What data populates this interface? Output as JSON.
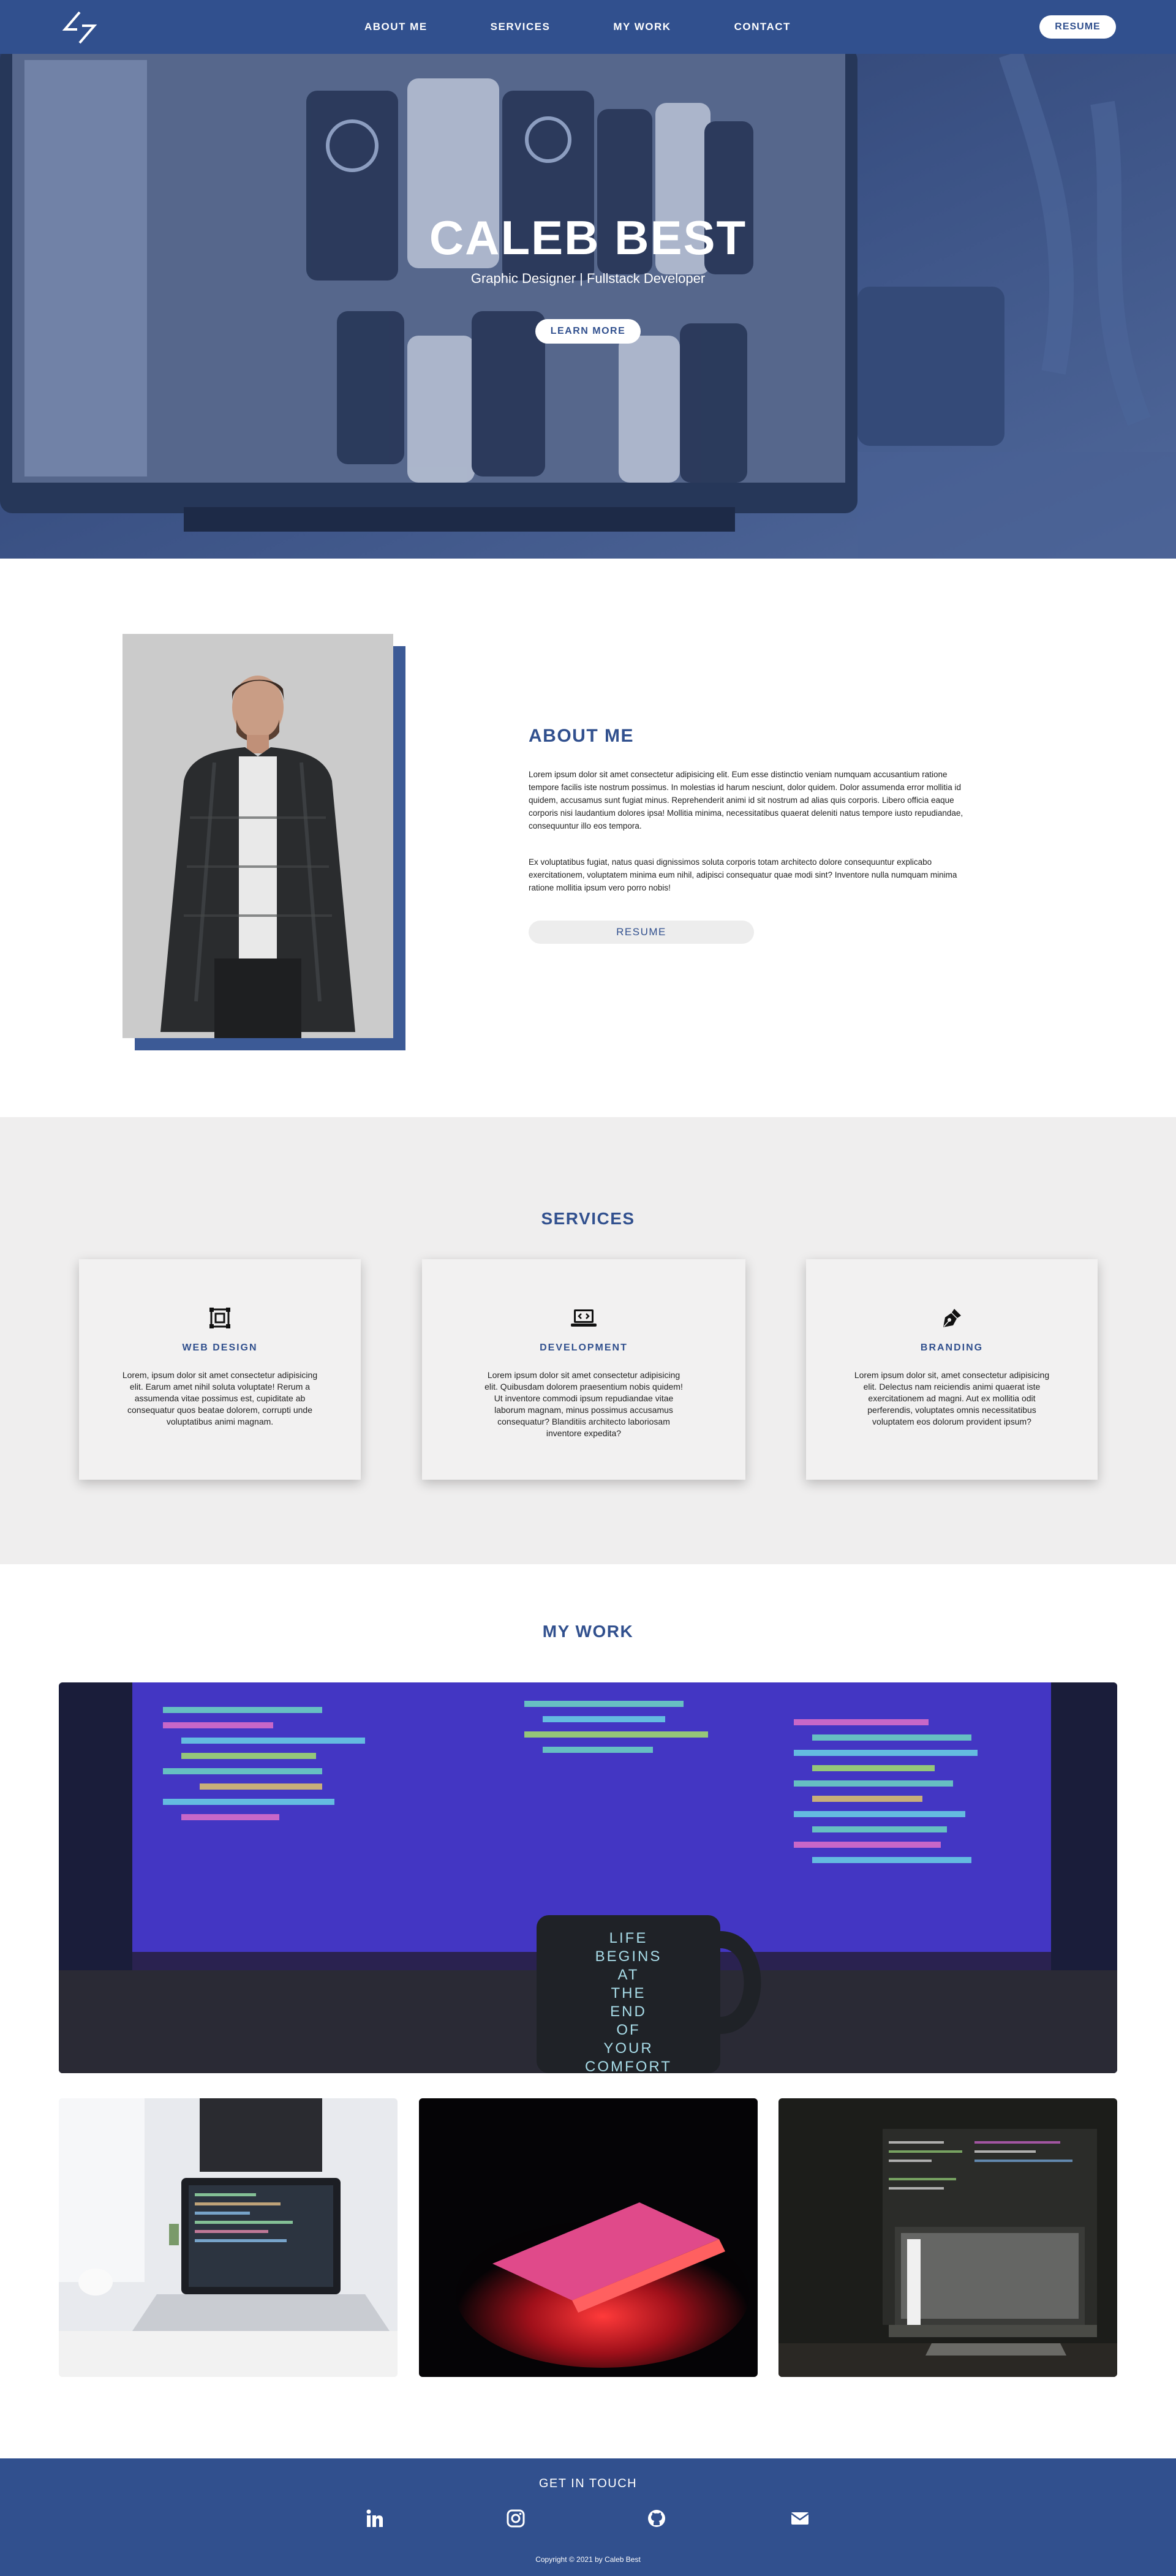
{
  "nav": {
    "logo_icon": "lightning-logo-icon",
    "links": [
      "ABOUT ME",
      "SERVICES",
      "MY WORK",
      "CONTACT"
    ],
    "resume_label": "RESUME"
  },
  "hero": {
    "title": "CALEB BEST",
    "subtitle": "Graphic Designer | Fullstack Developer",
    "button_label": "LEARN MORE"
  },
  "about": {
    "title": "ABOUT ME",
    "paragraph1": "Lorem ipsum dolor sit amet consectetur adipisicing elit. Eum esse distinctio veniam numquam accusantium ratione tempore facilis iste nostrum possimus. In molestias id harum nesciunt, dolor quidem. Dolor assumenda error mollitia id quidem, accusamus sunt fugiat minus. Reprehenderit animi id sit nostrum ad alias quis corporis. Libero officia eaque corporis nisi laudantium dolores ipsa! Mollitia minima, necessitatibus quaerat deleniti natus tempore iusto repudiandae, consequuntur illo eos tempora.",
    "paragraph2": "Ex voluptatibus fugiat, natus quasi dignissimos soluta corporis totam architecto dolore consequuntur explicabo exercitationem, voluptatem minima eum nihil, adipisci consequatur quae modi sint? Inventore nulla numquam minima ratione mollitia ipsum vero porro nobis!",
    "resume_label": "RESUME"
  },
  "services": {
    "title": "SERVICES",
    "cards": [
      {
        "icon": "web-design-icon",
        "title": "WEB DESIGN",
        "text": "Lorem, ipsum dolor sit amet consectetur adipisicing elit. Earum amet nihil soluta voluptate! Rerum a assumenda vitae possimus est, cupiditate ab consequatur quos beatae dolorem, corrupti unde voluptatibus animi magnam."
      },
      {
        "icon": "laptop-code-icon",
        "title": "DEVELOPMENT",
        "text": "Lorem ipsum dolor sit amet consectetur adipisicing elit. Quibusdam dolorem praesentium nobis quidem! Ut inventore commodi ipsum repudiandae vitae laborum magnam, minus possimus accusamus consequatur? Blanditiis architecto laboriosam inventore expedita?"
      },
      {
        "icon": "pen-nib-icon",
        "title": "BRANDING",
        "text": "Lorem ipsum dolor sit, amet consectetur adipisicing elit. Delectus nam reiciendis animi quaerat iste exercitationem ad magni. Aut ex mollitia odit perferendis, voluptates omnis necessitatibus voluptatem eos dolorum provident ipsum?"
      }
    ]
  },
  "work": {
    "title": "MY WORK",
    "mug_text": [
      "LIFE",
      "BEGINS",
      "AT",
      "THE",
      "END",
      "OF",
      "YOUR",
      "COMFORT"
    ]
  },
  "footer": {
    "title": "GET IN TOUCH",
    "icons": [
      "linkedin-icon",
      "instagram-icon",
      "github-icon",
      "envelope-icon"
    ],
    "copyright": "Copyright © 2021 by Caleb Best"
  },
  "colors": {
    "brand_blue": "#31508e",
    "services_bg": "#efeeee"
  }
}
